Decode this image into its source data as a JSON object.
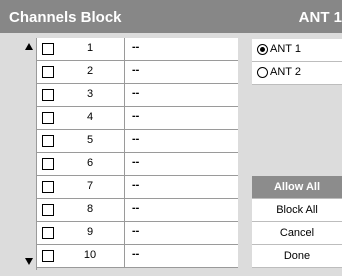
{
  "title": "Channels Block",
  "antenna_label": "ANT 1",
  "channels": [
    {
      "number": "1",
      "name": "--",
      "blocked": false
    },
    {
      "number": "2",
      "name": "--",
      "blocked": false
    },
    {
      "number": "3",
      "name": "--",
      "blocked": false
    },
    {
      "number": "4",
      "name": "--",
      "blocked": false
    },
    {
      "number": "5",
      "name": "--",
      "blocked": false
    },
    {
      "number": "6",
      "name": "--",
      "blocked": false
    },
    {
      "number": "7",
      "name": "--",
      "blocked": false
    },
    {
      "number": "8",
      "name": "--",
      "blocked": false
    },
    {
      "number": "9",
      "name": "--",
      "blocked": false
    },
    {
      "number": "10",
      "name": "--",
      "blocked": false
    }
  ],
  "antenna_options": [
    {
      "label": "ANT 1",
      "selected": true
    },
    {
      "label": "ANT 2",
      "selected": false
    }
  ],
  "buttons": {
    "allow_all": "Allow All",
    "block_all": "Block All",
    "cancel": "Cancel",
    "done": "Done"
  },
  "icons": {
    "scroll_up": "triangle-up-icon",
    "scroll_down": "triangle-down-icon"
  },
  "colors": {
    "title_bar": "#878787",
    "panel_background": "#dcdcdc",
    "active_button": "#8c8c8c"
  }
}
